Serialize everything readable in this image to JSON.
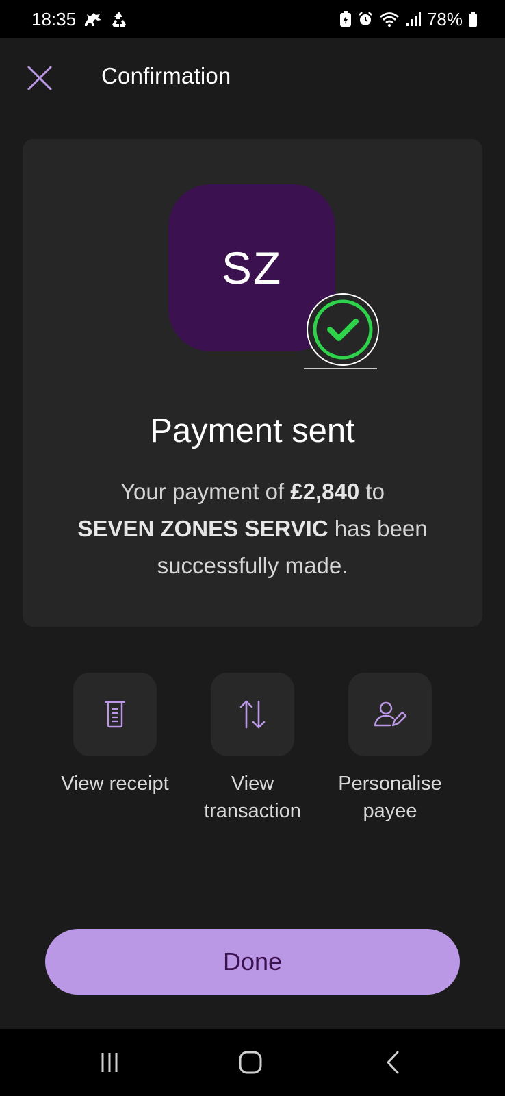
{
  "status_bar": {
    "time": "18:35",
    "battery_percent": "78%",
    "left_icons": [
      "horse-icon",
      "recycle-icon"
    ],
    "right_icons": [
      "battery-saver-icon",
      "alarm-icon",
      "wifi-icon",
      "signal-icon",
      "battery-icon"
    ]
  },
  "header": {
    "title": "Confirmation",
    "close_icon": "close-icon"
  },
  "card": {
    "avatar_initials": "SZ",
    "badge_icon": "check-icon",
    "title": "Payment sent",
    "message_prefix": "Your payment of ",
    "amount": "£2,840",
    "message_middle": " to ",
    "payee": "SEVEN ZONES SERVIC",
    "message_suffix": " has been successfully made."
  },
  "actions": [
    {
      "label": "View receipt",
      "icon": "receipt-icon"
    },
    {
      "label": "View transaction",
      "icon": "transfer-arrows-icon"
    },
    {
      "label": "Personalise payee",
      "icon": "user-edit-icon"
    }
  ],
  "done_button": {
    "label": "Done"
  },
  "nav_bar": {
    "icons": [
      "recent-apps-icon",
      "home-icon",
      "back-icon"
    ]
  },
  "colors": {
    "background": "#1b1b1b",
    "card": "#262626",
    "avatar": "#3b114f",
    "accent": "#bb98e6",
    "success": "#2fd24b"
  }
}
